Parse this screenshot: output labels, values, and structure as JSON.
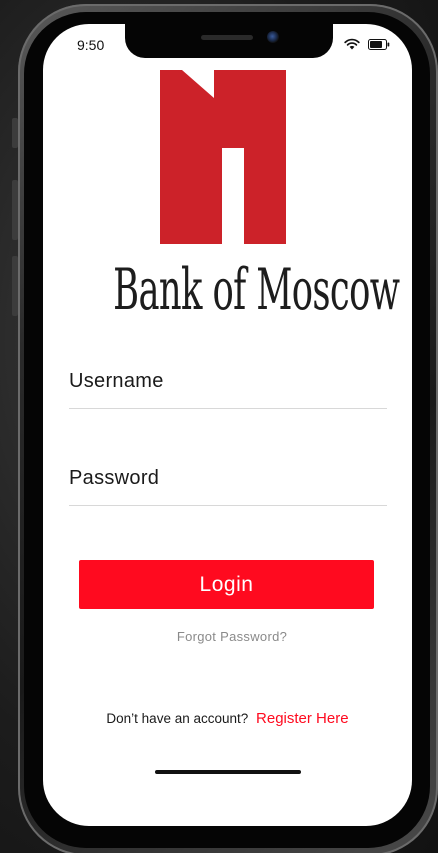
{
  "status_bar": {
    "time": "9:50",
    "icons": [
      "wifi-icon",
      "battery-icon"
    ]
  },
  "brand": {
    "name": "Bank of Moscow",
    "logo": "bank-of-moscow-logo",
    "logo_color": "#cc2229"
  },
  "form": {
    "username_label": "Username",
    "password_label": "Password",
    "login_label": "Login",
    "forgot_label": "Forgot Password?"
  },
  "footer": {
    "prompt": "Don’t have an account?",
    "register_label": "Register Here"
  },
  "colors": {
    "accent": "#ff0a1f",
    "muted_text": "#8a8a8a",
    "divider": "#d8d8d8"
  }
}
